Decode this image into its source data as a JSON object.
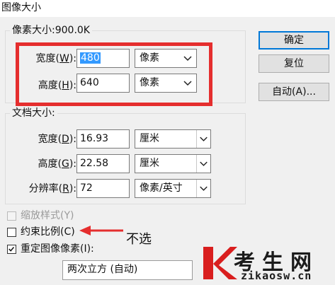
{
  "window": {
    "title": "图像大小"
  },
  "pixel_dimensions": {
    "legend": "像素大小:900.0K",
    "width": {
      "label": "宽度",
      "hotkey": "W",
      "value": "480",
      "unit": "像素"
    },
    "height": {
      "label": "高度",
      "hotkey": "H",
      "value": "640",
      "unit": "像素"
    }
  },
  "document_size": {
    "legend": "文档大小:",
    "width": {
      "label": "宽度",
      "hotkey": "D",
      "value": "16.93",
      "unit": "厘米"
    },
    "height": {
      "label": "高度",
      "hotkey": "G",
      "value": "22.58",
      "unit": "厘米"
    },
    "resolution": {
      "label": "分辨率",
      "hotkey": "R",
      "value": "72",
      "unit": "像素/英寸"
    }
  },
  "buttons": {
    "ok": "确定",
    "reset": "复位",
    "auto": "自动(A)..."
  },
  "options": {
    "scale_styles": {
      "label": "缩放样式(Y)",
      "checked": false,
      "enabled": false
    },
    "constrain": {
      "label": "约束比例(C)",
      "checked": false,
      "enabled": true
    },
    "resample": {
      "label": "重定图像像素(I):",
      "checked": true,
      "enabled": true
    }
  },
  "resample_method": "两次立方 (自动)",
  "annotation": {
    "text": "不选",
    "color": "#e52e2e"
  },
  "watermark": {
    "text": "考生网",
    "url": "zikaosw.cn",
    "logo_color": "#d91e1e"
  },
  "colors": {
    "selection": "#3399ff",
    "highlight_box": "#e52e2e",
    "default_button_border": "#0078d7"
  }
}
